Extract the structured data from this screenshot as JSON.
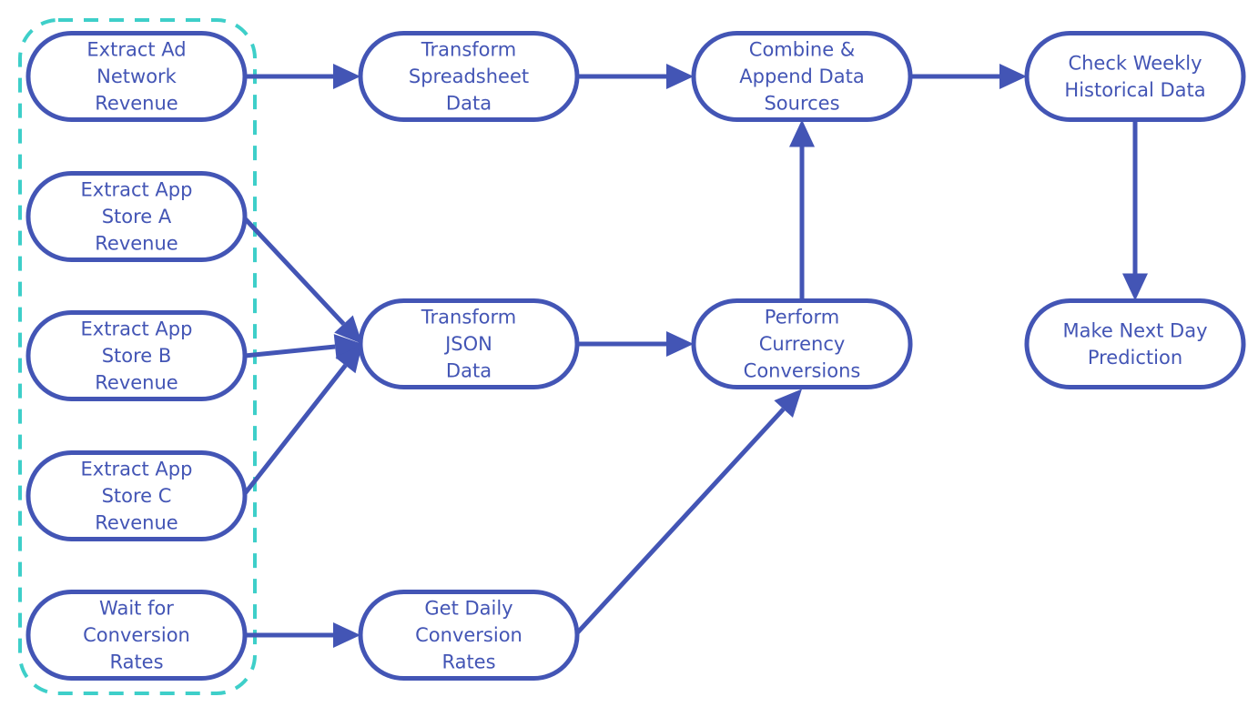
{
  "diagram": {
    "colors": {
      "node": "#4355b5",
      "group_border": "#3ecfc9",
      "background": "#ffffff"
    },
    "group": {
      "name": "extract-stage",
      "style": "dashed",
      "members": [
        "extract_ad",
        "extract_a",
        "extract_b",
        "extract_c",
        "wait_rates"
      ]
    },
    "nodes": [
      {
        "id": "extract_ad",
        "lines": [
          "Extract Ad",
          "Network",
          "Revenue"
        ]
      },
      {
        "id": "extract_a",
        "lines": [
          "Extract  App",
          "Store A",
          "Revenue"
        ]
      },
      {
        "id": "extract_b",
        "lines": [
          "Extract App",
          "Store B",
          "Revenue"
        ]
      },
      {
        "id": "extract_c",
        "lines": [
          "Extract App",
          "Store C",
          "Revenue"
        ]
      },
      {
        "id": "wait_rates",
        "lines": [
          "Wait for",
          "Conversion",
          "Rates"
        ]
      },
      {
        "id": "transform_sheet",
        "lines": [
          "Transform",
          "Spreadsheet",
          "Data"
        ]
      },
      {
        "id": "transform_json",
        "lines": [
          "Transform",
          "JSON",
          "Data"
        ]
      },
      {
        "id": "get_rates",
        "lines": [
          "Get Daily",
          "Conversion",
          "Rates"
        ]
      },
      {
        "id": "combine",
        "lines": [
          "Combine &",
          "Append Data",
          "Sources"
        ]
      },
      {
        "id": "currency",
        "lines": [
          "Perform",
          "Currency",
          "Conversions"
        ]
      },
      {
        "id": "check_weekly",
        "lines": [
          "Check Weekly",
          "Historical Data"
        ]
      },
      {
        "id": "predict",
        "lines": [
          "Make Next Day",
          "Prediction"
        ]
      }
    ],
    "edges": [
      {
        "from": "extract_ad",
        "to": "transform_sheet"
      },
      {
        "from": "extract_a",
        "to": "transform_json"
      },
      {
        "from": "extract_b",
        "to": "transform_json"
      },
      {
        "from": "extract_c",
        "to": "transform_json"
      },
      {
        "from": "wait_rates",
        "to": "get_rates"
      },
      {
        "from": "transform_sheet",
        "to": "combine"
      },
      {
        "from": "transform_json",
        "to": "currency"
      },
      {
        "from": "get_rates",
        "to": "currency"
      },
      {
        "from": "currency",
        "to": "combine"
      },
      {
        "from": "combine",
        "to": "check_weekly"
      },
      {
        "from": "check_weekly",
        "to": "predict"
      }
    ]
  }
}
